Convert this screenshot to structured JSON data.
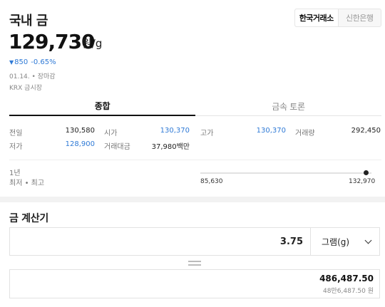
{
  "header": {
    "title": "국내 금",
    "sources": [
      "한국거래소",
      "신한은행"
    ],
    "active_source": "한국거래소"
  },
  "price": {
    "value": "129,730",
    "unit": "원/g",
    "change": "850",
    "change_pct": "-0.65%",
    "direction": "down",
    "date": "01.14.",
    "status": "장마감",
    "market": "KRX 금시장"
  },
  "tabs": [
    "종합",
    "금속 토론"
  ],
  "stats": {
    "prev_close": {
      "label": "전일",
      "value": "130,580"
    },
    "open": {
      "label": "시가",
      "value": "130,370"
    },
    "high": {
      "label": "고가",
      "value": "130,370"
    },
    "volume": {
      "label": "거래량",
      "value": "292,450"
    },
    "low": {
      "label": "저가",
      "value": "128,900"
    },
    "turnover": {
      "label": "거래대금",
      "value": "37,980백만"
    }
  },
  "range": {
    "period": "1년",
    "label": "최저 • 최고",
    "min": "85,630",
    "max": "132,970",
    "position": 0.97
  },
  "calculator": {
    "title": "금 계산기",
    "amount": "3.75",
    "unit": "그램(g)",
    "result": "486,487.50",
    "result_korean": "48만6,487.50 원"
  },
  "colors": {
    "down": "#2f7ad6",
    "text": "#222222"
  }
}
